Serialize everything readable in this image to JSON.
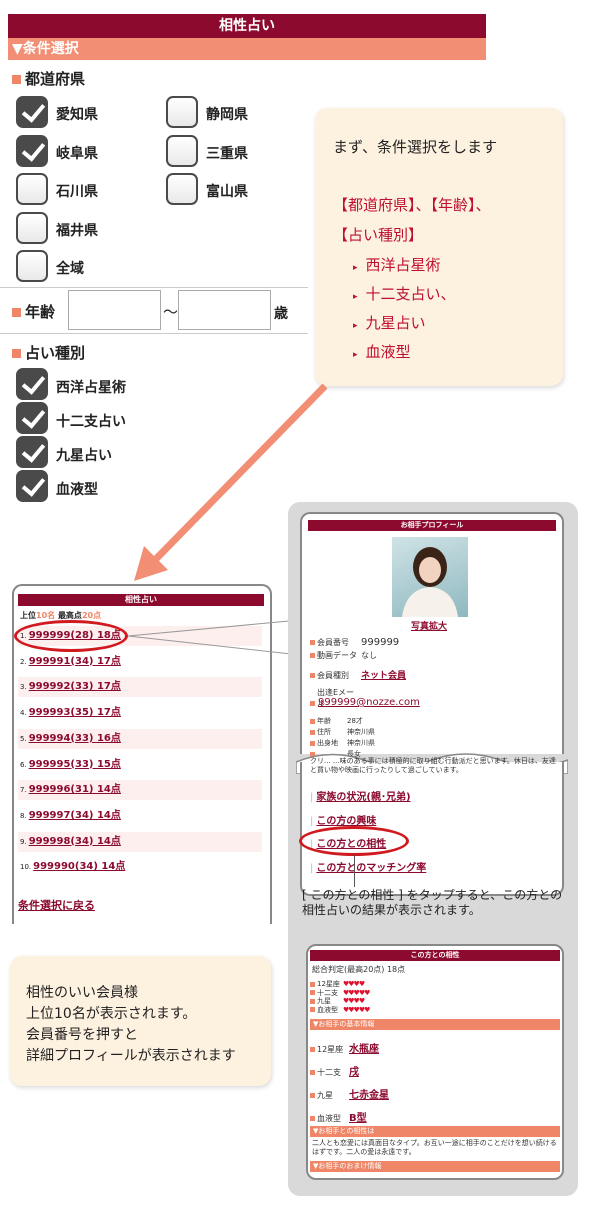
{
  "top_screen": {
    "title": "相性占い",
    "section": "▼条件選択",
    "prefecture_label": "都道府県",
    "prefectures": [
      {
        "label": "愛知県",
        "checked": true
      },
      {
        "label": "静岡県",
        "checked": false
      },
      {
        "label": "岐阜県",
        "checked": true
      },
      {
        "label": "三重県",
        "checked": false
      },
      {
        "label": "石川県",
        "checked": false
      },
      {
        "label": "富山県",
        "checked": false
      },
      {
        "label": "福井県",
        "checked": false
      },
      {
        "label": "全域",
        "checked": false
      }
    ],
    "age_label": "年齢",
    "age_tilde": "〜",
    "age_unit": "歳",
    "fortune_label": "占い種別",
    "fortunes": [
      {
        "label": "西洋占星術",
        "checked": true
      },
      {
        "label": "十二支占い",
        "checked": true
      },
      {
        "label": "九星占い",
        "checked": true
      },
      {
        "label": "血液型",
        "checked": true
      }
    ]
  },
  "callout1": {
    "line1": "まず、条件選択をします",
    "line2": "【都道府県】、【年齢】、",
    "line3": "【占い種別】",
    "items": [
      "西洋占星術",
      "十二支占い、",
      "九星占い",
      "血液型"
    ]
  },
  "results_screen": {
    "title": "相性占い",
    "sub_prefix": "上位",
    "sub_top": "10名",
    "sub_mid": "最高点",
    "sub_max": "20点",
    "rows": [
      {
        "no": "1.",
        "text": "999999(28) 18点"
      },
      {
        "no": "2.",
        "text": "999991(34) 17点"
      },
      {
        "no": "3.",
        "text": "999992(33) 17点"
      },
      {
        "no": "4.",
        "text": "999993(35) 17点"
      },
      {
        "no": "5.",
        "text": "999994(33) 16点"
      },
      {
        "no": "6.",
        "text": "999995(33) 15点"
      },
      {
        "no": "7.",
        "text": "999996(31) 14点"
      },
      {
        "no": "8.",
        "text": "999997(34) 14点"
      },
      {
        "no": "9.",
        "text": "999998(34) 14点"
      },
      {
        "no": "10.",
        "text": "999990(34) 14点"
      }
    ],
    "back_link": "条件選択に戻る"
  },
  "callout2": {
    "lines": [
      "相性のいい会員様",
      "上位10名が表示されます。",
      "会員番号を押すと",
      "詳細プロフィールが表示されます"
    ]
  },
  "profile_screen": {
    "title": "お相手プロフィール",
    "photo_link": "写真拡大",
    "fields": [
      {
        "label": "会員番号",
        "value": "999999"
      },
      {
        "label": "動画データ",
        "value": "なし"
      },
      {
        "label": "会員種別",
        "value": "ネット会員"
      },
      {
        "label": "出逢Eメール",
        "value": ""
      }
    ],
    "email": "999999@nozze.com",
    "fields2": [
      {
        "label": "年齢",
        "value": "28才"
      },
      {
        "label": "住所",
        "value": "神奈川県"
      },
      {
        "label": "出身地",
        "value": "神奈川県"
      },
      {
        "label": "",
        "value": "長女"
      }
    ],
    "intro": "クリ... ...味のある事には積極的に取り組む行動派だと思います。休日は、友達と買い物や映画に行ったりして過ごしています。",
    "links": [
      "家族の状況(親･兄弟)",
      "この方の興味",
      "この方との相性",
      "この方とのマッチング率"
    ]
  },
  "tap_note": "[ この方との相性 ] をタップすると、この方との相性占いの結果が表示されます。",
  "compat_screen": {
    "title": "この方との相性",
    "total": "総合判定(最高20点) 18点",
    "hearts": [
      {
        "label": "12星座",
        "hearts": "♥♥♥♥"
      },
      {
        "label": "十二支",
        "hearts": "♥♥♥♥♥"
      },
      {
        "label": "九星",
        "hearts": "♥♥♥♥"
      },
      {
        "label": "血液型",
        "hearts": "♥♥♥♥♥"
      }
    ],
    "basic_header": "▼お相手の基本情報",
    "basic": [
      {
        "label": "12星座",
        "value": "水瓶座"
      },
      {
        "label": "十二支",
        "value": "戌"
      },
      {
        "label": "九星",
        "value": "七赤金星"
      },
      {
        "label": "血液型",
        "value": "B型"
      }
    ],
    "compat_header": "▼お相手との相性は",
    "compat_text": "二人とも恋愛には真面目なタイプ。お互い一途に相手のことだけを想い続けるはずです。二人の愛は永遠です。",
    "bottom_header": "▼お相手のおまけ情報"
  },
  "colors": {
    "brand": "#8c0a2e",
    "accent": "#ef8668",
    "callout_bg": "#fdf1e0"
  }
}
